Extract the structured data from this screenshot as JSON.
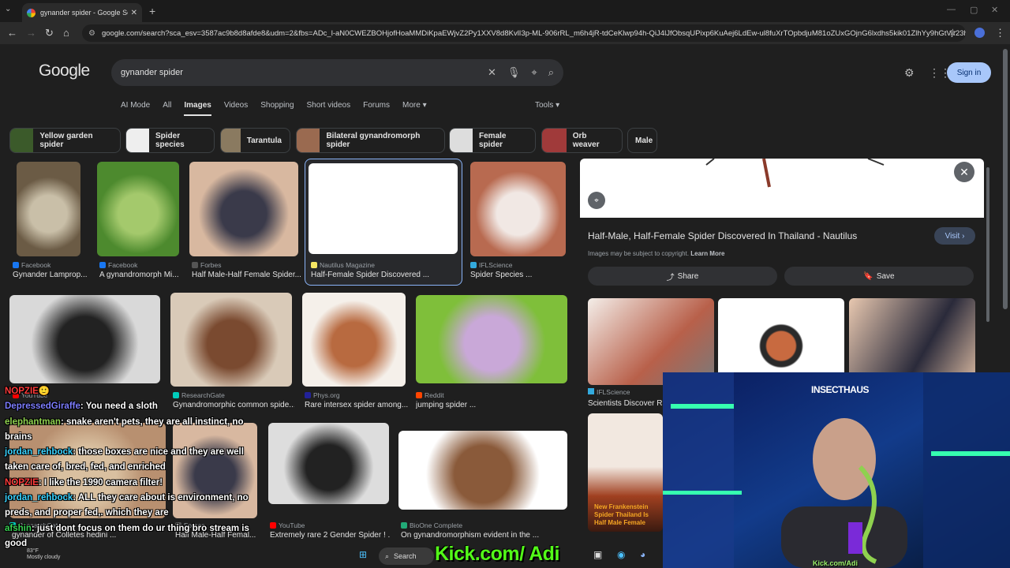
{
  "browser": {
    "tab_title": "gynander spider - Google Search",
    "url": "google.com/search?sca_esv=3587ac9b8d8afde8&udm=2&fbs=ADc_l-aN0CWEZBOHjofHoaMMDiKpaEWjvZ2Py1XXV8d8KvlI3p-ML-906rRL_m6h4jR-tdCeKlwp94h-QiJ4lJfObsqUPixp6KuAej6LdEw-ul8fuXrTOpbdjuM81oZUxGOjnG6lxdhs5kik01ZlhYy9hGtVjr23hG..."
  },
  "google": {
    "logo": "Google",
    "query": "gynander spider",
    "sign_in": "Sign in",
    "tabs": [
      "AI Mode",
      "All",
      "Images",
      "Videos",
      "Shopping",
      "Short videos",
      "Forums",
      "More ▾"
    ],
    "active_tab": "Images",
    "tools": "Tools ▾"
  },
  "chips": [
    {
      "label": "Yellow garden spider",
      "color": "#3b5a2a"
    },
    {
      "label": "Spider species",
      "color": "#eee"
    },
    {
      "label": "Tarantula",
      "color": "#8a7a60"
    },
    {
      "label": "Bilateral gynandromorph spider",
      "color": "#9a6a50"
    },
    {
      "label": "Female spider",
      "color": "#ddd"
    },
    {
      "label": "Orb weaver",
      "color": "#a03a3a"
    },
    {
      "label": "Male",
      "color": ""
    }
  ],
  "results": [
    {
      "source": "Facebook",
      "caption": "Gynander Lamprop...",
      "icon_color": "#1877f2",
      "colors": [
        "#6b5b45",
        "#c9bfa8"
      ]
    },
    {
      "source": "Facebook",
      "caption": "A gynandromorph Mi...",
      "icon_color": "#1877f2",
      "colors": [
        "#4d8a2e",
        "#a4c96c"
      ]
    },
    {
      "source": "Forbes",
      "caption": "Half Male-Half Female Spider...",
      "icon_color": "#555",
      "colors": [
        "#d8b8a0",
        "#3a3a4a"
      ]
    },
    {
      "source": "Nautilus Magazine",
      "caption": "Half-Female Spider Discovered ...",
      "icon_color": "#f5e663",
      "colors": [
        "#ffffff",
        "#ffffff"
      ]
    },
    {
      "source": "IFLScience",
      "caption": "Spider Species ...",
      "icon_color": "#3ad",
      "colors": [
        "#b86a50",
        "#f1e8e4"
      ]
    },
    {
      "source": "YouTube",
      "caption": "",
      "icon_color": "#f00",
      "colors": [
        "#d9d9d9",
        "#222"
      ]
    },
    {
      "source": "ResearchGate",
      "caption": "Gynandromorphic common spide...",
      "icon_color": "#0cb",
      "colors": [
        "#d9cab8",
        "#7a4a30"
      ]
    },
    {
      "source": "Phys.org",
      "caption": "Rare intersex spider among...",
      "icon_color": "#229",
      "colors": [
        "#f5f0ea",
        "#b86a40"
      ]
    },
    {
      "source": "Reddit",
      "caption": "jumping spider ...",
      "icon_color": "#ff4500",
      "colors": [
        "#7fbf3a",
        "#c9a8d8"
      ]
    },
    {
      "source": "ResearchGate",
      "caption": "gynander of Colletes hedini ...",
      "icon_color": "#0cb",
      "colors": [
        "#b89070",
        "#d9c0a0"
      ]
    },
    {
      "source": "Forbes",
      "caption": "Half Male-Half Femal...",
      "icon_color": "#555",
      "colors": [
        "#d8b8a0",
        "#3a3a4a"
      ]
    },
    {
      "source": "YouTube",
      "caption": "Extremely rare 2 Gender Spider ! ...",
      "icon_color": "#f00",
      "colors": [
        "#ddd",
        "#222"
      ]
    },
    {
      "source": "BioOne Complete",
      "caption": "On gynandromorphism evident in the ...",
      "icon_color": "#2a7",
      "colors": [
        "#fff",
        "#8a5a3a"
      ]
    }
  ],
  "panel": {
    "title": "Half-Male, Half-Female Spider Discovered In Thailand - Nautilus",
    "visit": "Visit ›",
    "copyright": "Images may be subject to copyright.",
    "learn_more": "Learn More",
    "share": "Share",
    "save": "Save",
    "related_source": "IFLScience",
    "related_caption": "Scientists Discover Rare",
    "thumb_text": "New Frankenstein Spider Thailand Is Half Male Female"
  },
  "chat": [
    {
      "user": "NOPZIE",
      "msg": "🙂",
      "cls": "n1"
    },
    {
      "user": "DepressedGiraffe",
      "msg": ": You need a sloth",
      "cls": "n2"
    },
    {
      "user": "elephantman",
      "msg": ": snake aren't pets, they are all instinct, no brains",
      "cls": "n3"
    },
    {
      "user": "jordan_rehbock",
      "msg": ": those boxes are nice and they are well taken care of, bred, fed, and enriched",
      "cls": "n4"
    },
    {
      "user": "NOPZIE",
      "msg": ": I like the 1990 camera filter!",
      "cls": "n1"
    },
    {
      "user": "jordan_rehbock",
      "msg": ": ALL they care about is environment, no preds, and proper fed,. which they are",
      "cls": "n4"
    },
    {
      "user": "afshin",
      "msg": ": just dont focus on them do ur thing bro stream is good",
      "cls": "n5"
    }
  ],
  "stream": {
    "kick_banner": "Kick.com/ Adi",
    "cam_label": "Kick.com/Adi",
    "wall_sign": "INSECTHAUS"
  },
  "taskbar": {
    "search": "Search",
    "weather": "83°F\nMostly cloudy"
  }
}
